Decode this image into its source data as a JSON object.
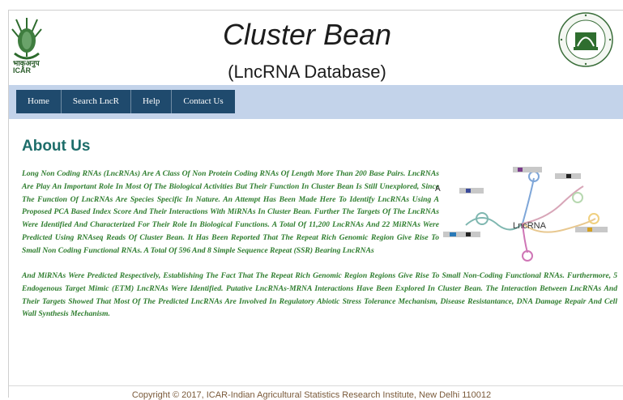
{
  "header": {
    "title": "Cluster Bean",
    "subtitle": "(LncRNA Database)",
    "left_logo_text_1": "भाकृअनुप",
    "left_logo_text_2": "ICAR"
  },
  "nav": {
    "items": [
      {
        "label": "Home"
      },
      {
        "label": "Search LncR"
      },
      {
        "label": "Help"
      },
      {
        "label": "Contact Us"
      }
    ]
  },
  "main": {
    "heading": "About Us",
    "paragraph_part1": "Long Non Coding RNAs (LncRNAs) Are A Class Of Non Protein Coding RNAs Of Length More Than 200 Base Pairs. LncRNAs Are Play An Important Role In Most Of The Biological Activities But Their Function In Cluster Bean Is Still Unexplored, Since The Function Of LncRNAs Are Species Specific In Nature. An Attempt Has Been Made Here To Identify LncRNAs Using A Proposed PCA Based Index Score And Their Interactions With MiRNAs In Cluster Bean. Further The Targets Of The LncRNAs Were Identified And Characterized For Their Role In Biological Functions. A Total Of 11,200 LncRNAs And 22 MiRNAs Were Predicted Using RNAseq Reads Of Cluster Bean. It Has Been Reported That The Repeat Rich Genomic Region Give Rise To Small Non Coding Functional RNAs. A Total Of 596 And 8 Simple Sequence Repeat (SSR) Bearing LncRNAs",
    "paragraph_part2": "And MiRNAs Were Predicted Respectively, Establishing The Fact That The Repeat Rich Genomic Region Regions Give Rise To Small Non-Coding Functional RNAs. Furthermore, 5 Endogenous Target Mimic (ETM) LncRNAs Were Identified. Putative LncRNAs-MRNA Interactions Have Been Explored In Cluster Bean. The Interaction Between LncRNAs And Their Targets Showed That Most Of The Predicted LncRNAs Are Involved In Regulatory Abiotic Stress Tolerance Mechanism, Disease Resistantance, DNA Damage Repair And Cell Wall Synthesis Mechanism.",
    "figure_letter": "A",
    "figure_label": "LncRNA"
  },
  "footer": {
    "text": "Copyright © 2017, ICAR-Indian Agricultural Statistics Research Institute, New Delhi 110012"
  }
}
